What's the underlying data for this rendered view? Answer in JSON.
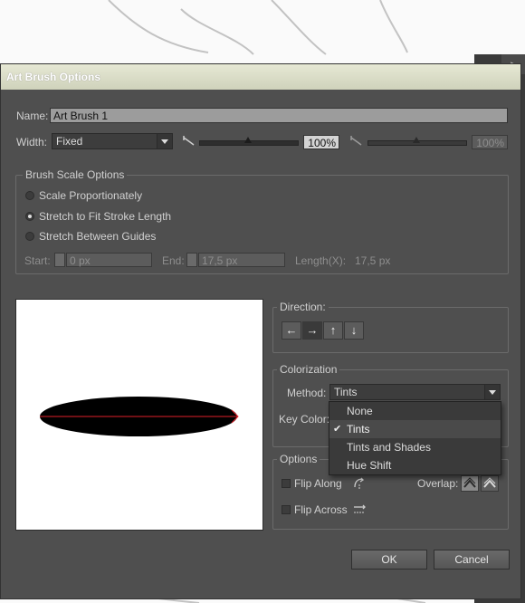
{
  "dialog": {
    "title": "Art Brush Options"
  },
  "name": {
    "label": "Name:",
    "value": "Art Brush 1"
  },
  "width": {
    "label": "Width:",
    "mode": "Fixed",
    "primary_value": "100%",
    "secondary_value": "100%",
    "primary_slider_level": 0.5,
    "secondary_slider_level": 0.5
  },
  "scale_options": {
    "title": "Brush Scale Options",
    "radios": [
      {
        "label": "Scale Proportionately",
        "selected": false
      },
      {
        "label": "Stretch to Fit Stroke Length",
        "selected": true
      },
      {
        "label": "Stretch Between Guides",
        "selected": false
      }
    ],
    "start_label": "Start:",
    "start_value": "0 px",
    "end_label": "End:",
    "end_value": "17,5 px",
    "length_label": "Length(X):",
    "length_value": "17,5 px"
  },
  "direction": {
    "title": "Direction:",
    "arrows": [
      "←",
      "→",
      "↑",
      "↓"
    ],
    "selected_index": 1
  },
  "colorization": {
    "title": "Colorization",
    "method_label": "Method:",
    "method_value": "Tints",
    "key_color_label": "Key Color:",
    "options": [
      "None",
      "Tints",
      "Tints and Shades",
      "Hue Shift"
    ],
    "selected_index": 1
  },
  "options": {
    "title": "Options",
    "flip_along": "Flip Along",
    "flip_across": "Flip Across",
    "overlap_label": "Overlap:"
  },
  "buttons": {
    "ok": "OK",
    "cancel": "Cancel"
  },
  "colors": {
    "dialog_bg": "#4f4f4f",
    "title_bar": "#dcdec8",
    "preview_guide": "#e0202a",
    "brush": "#000000"
  }
}
